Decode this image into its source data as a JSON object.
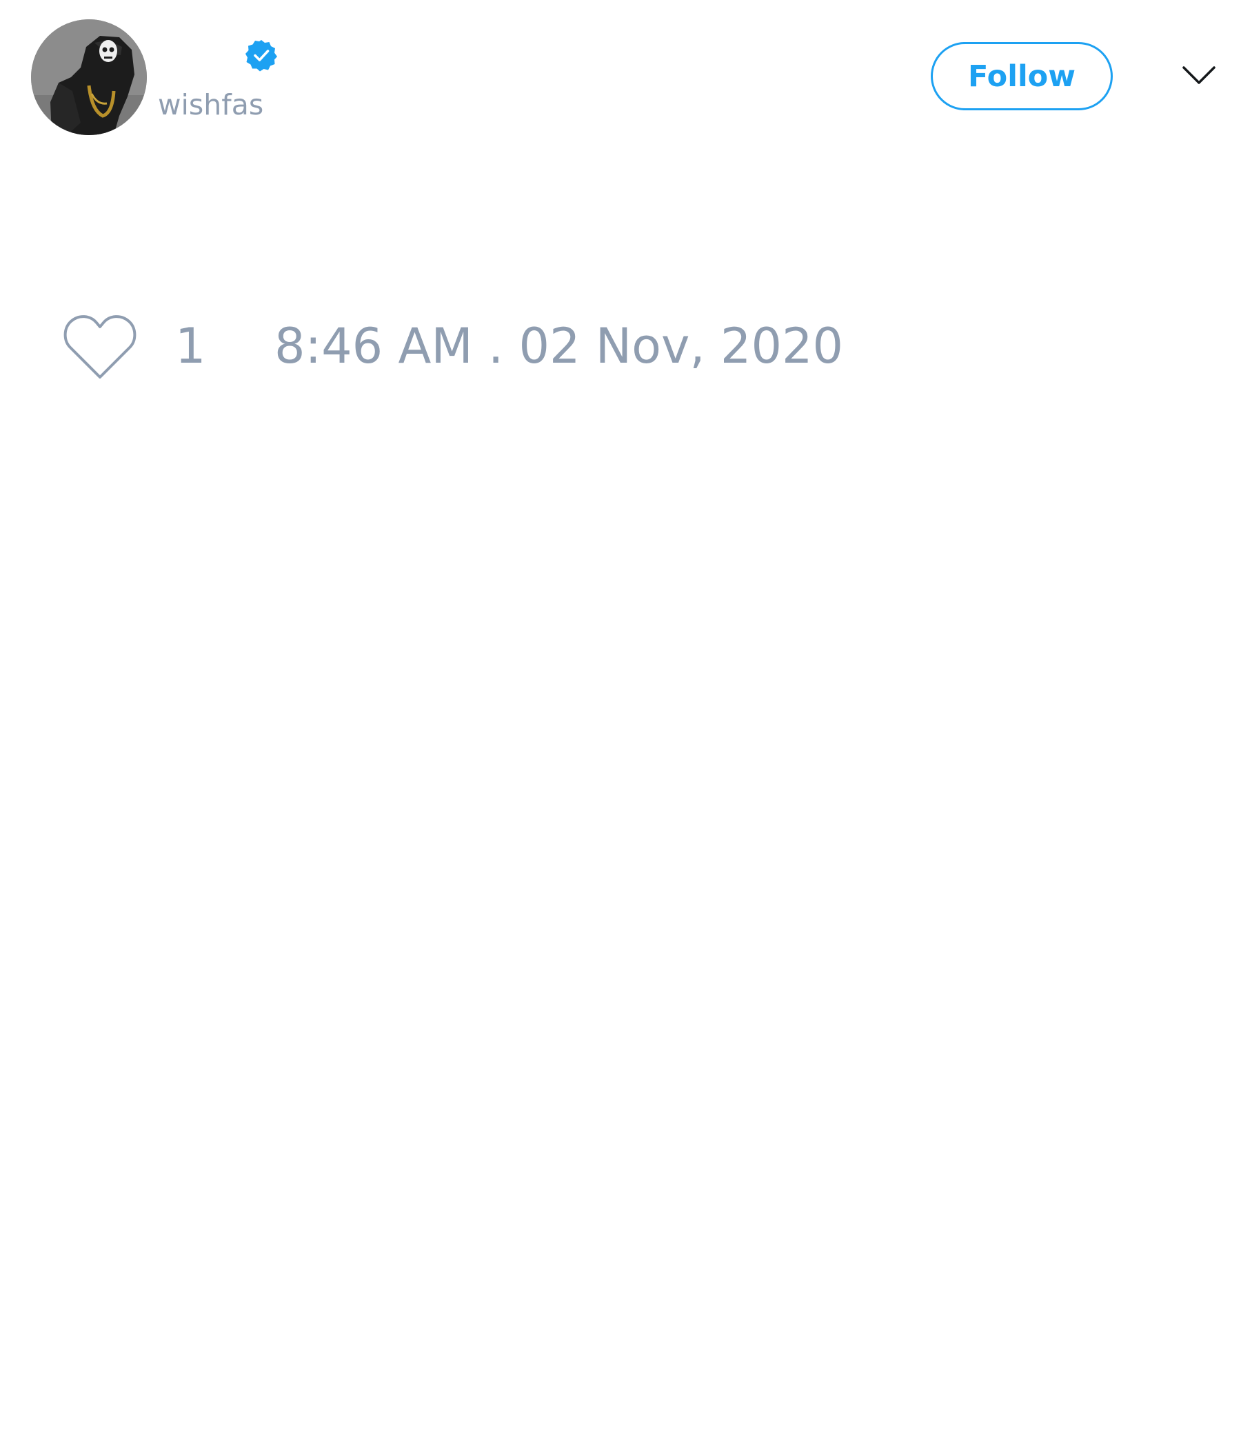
{
  "tweet": {
    "author": {
      "display_name": "",
      "handle": "wishfas",
      "verified": true,
      "avatar_icon": "avatar-photo"
    },
    "follow_label": "Follow",
    "menu_icon": "chevron-down-icon",
    "likes": {
      "icon": "heart-icon",
      "count": "1"
    },
    "timestamp": "8:46 AM . 02 Nov, 2020"
  },
  "colors": {
    "accent": "#1da1f2",
    "secondary_text": "#8f9db0",
    "background": "#ffffff"
  }
}
